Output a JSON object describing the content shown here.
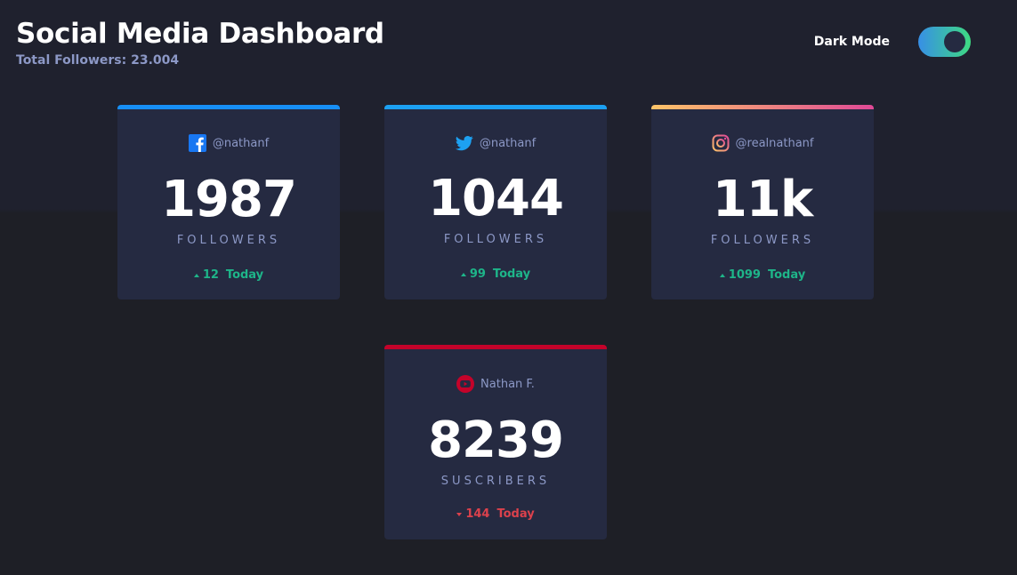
{
  "header": {
    "title": "Social Media Dashboard",
    "subtitle": "Total Followers: 23.004",
    "mode_label": "Dark Mode",
    "dark_mode_on": true
  },
  "colors": {
    "facebook": "#1877f2",
    "twitter": "#1da1f2",
    "instagram_start": "#fdc468",
    "instagram_end": "#df4996",
    "youtube": "#c4032a",
    "up": "#1eb589",
    "down": "#dc414c"
  },
  "cards": [
    {
      "platform": "facebook",
      "icon": "facebook-icon",
      "handle": "@nathanf",
      "count": "1987",
      "label": "FOLLOWERS",
      "change": "12",
      "change_direction": "up",
      "period": "Today"
    },
    {
      "platform": "twitter",
      "icon": "twitter-icon",
      "handle": "@nathanf",
      "count": "1044",
      "label": "FOLLOWERS",
      "change": "99",
      "change_direction": "up",
      "period": "Today"
    },
    {
      "platform": "instagram",
      "icon": "instagram-icon",
      "handle": "@realnathanf",
      "count": "11k",
      "label": "FOLLOWERS",
      "change": "1099",
      "change_direction": "up",
      "period": "Today"
    },
    {
      "platform": "youtube",
      "icon": "youtube-icon",
      "handle": "Nathan F.",
      "count": "8239",
      "label": "SUSCRIBERS",
      "change": "144",
      "change_direction": "down",
      "period": "Today"
    }
  ]
}
